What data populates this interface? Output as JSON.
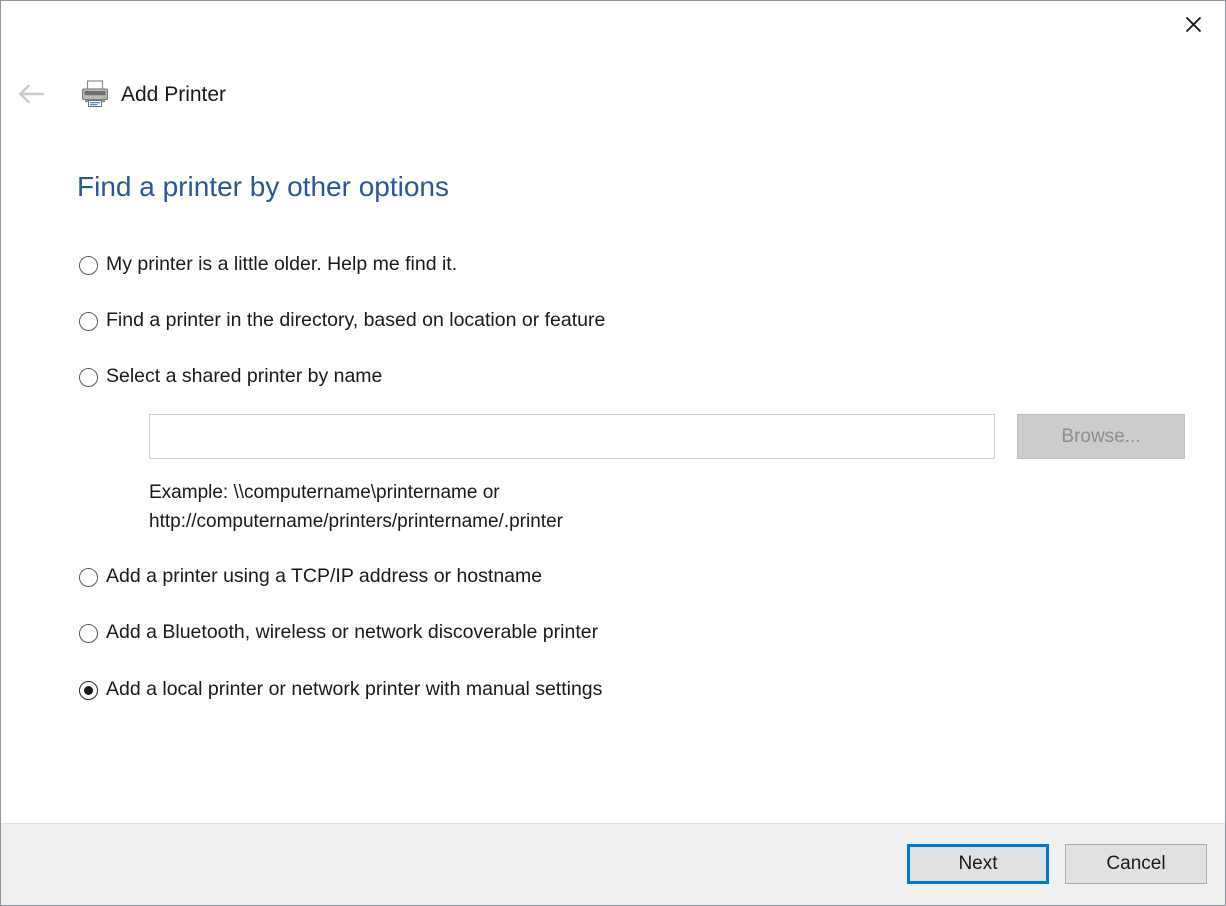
{
  "window": {
    "caption": "Add Printer",
    "printer_icon": "printer-icon",
    "back_icon": "back-arrow-icon",
    "close_icon": "close-icon"
  },
  "heading": "Find a printer by other options",
  "heading_color": "#2b579a",
  "options": [
    {
      "label": "My printer is a little older. Help me find it.",
      "selected": false
    },
    {
      "label": "Find a printer in the directory, based on location or feature",
      "selected": false
    },
    {
      "label": "Select a shared printer by name",
      "selected": false
    },
    {
      "label": "Add a printer using a TCP/IP address or hostname",
      "selected": false
    },
    {
      "label": "Add a Bluetooth, wireless or network discoverable printer",
      "selected": false
    },
    {
      "label": "Add a local printer or network printer with manual settings",
      "selected": true
    }
  ],
  "share_name": {
    "value": "",
    "placeholder": "",
    "browse_label": "Browse...",
    "browse_enabled": false
  },
  "example_text": "Example: \\\\computername\\printername or\nhttp://computername/printers/printername/.printer",
  "footer": {
    "next_label": "Next",
    "cancel_label": "Cancel",
    "focus_color": "#0078d7"
  }
}
